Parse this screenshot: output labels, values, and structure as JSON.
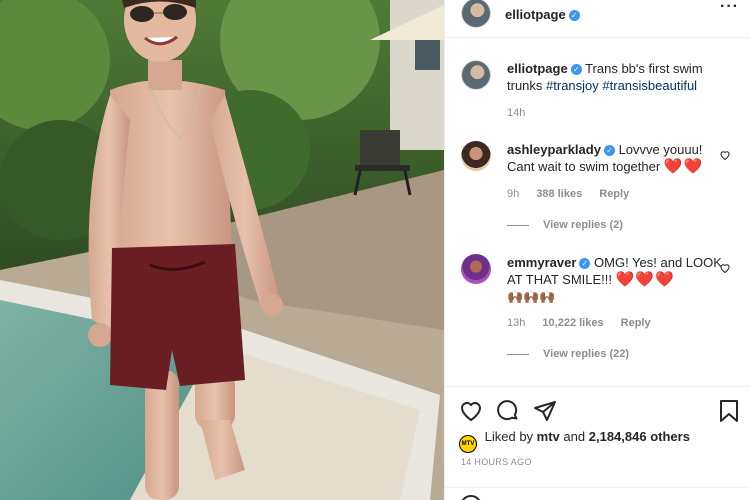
{
  "post": {
    "username": "elliotpage",
    "caption_text": "Trans bb's first swim trunks",
    "hashtags": [
      "#transjoy",
      "#transisbeautiful"
    ],
    "caption_time": "14h"
  },
  "comments": [
    {
      "username": "ashleyparklady",
      "text": "Lovvve youuu! Cant wait to swim together",
      "emoji": "❤️❤️",
      "time": "9h",
      "likes": "388 likes",
      "reply_label": "Reply",
      "view_replies": "View replies (2)"
    },
    {
      "username": "emmyraver",
      "text": "OMG! Yes! and LOOK AT THAT SMILE!!!",
      "emoji": "❤️❤️❤️",
      "emoji_line2": "🙌🏾🙌🏾🙌🏾",
      "time": "13h",
      "likes": "10,222 likes",
      "reply_label": "Reply",
      "view_replies": "View replies (22)"
    }
  ],
  "likes": {
    "prefix": "Liked by",
    "liker": "mtv",
    "joiner": "and",
    "others": "2,184,846 others",
    "badge": "MTV"
  },
  "timestamp": "14 HOURS AGO",
  "icons": {
    "more": "more-dots-icon",
    "like": "heart-icon",
    "comment": "comment-bubble-icon",
    "share": "paper-plane-icon",
    "save": "bookmark-icon"
  },
  "colors": {
    "link": "#003569",
    "verified": "#3897f0",
    "heart": "#ed1c24",
    "muted": "#8e8e8e"
  }
}
